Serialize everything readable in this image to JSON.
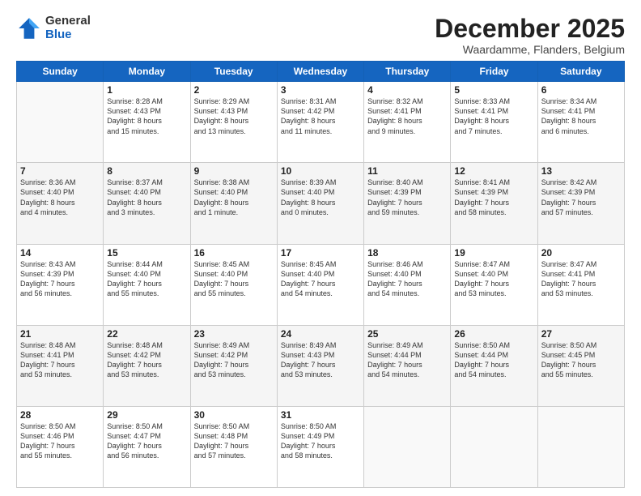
{
  "logo": {
    "general": "General",
    "blue": "Blue"
  },
  "header": {
    "month": "December 2025",
    "location": "Waardamme, Flanders, Belgium"
  },
  "weekdays": [
    "Sunday",
    "Monday",
    "Tuesday",
    "Wednesday",
    "Thursday",
    "Friday",
    "Saturday"
  ],
  "weeks": [
    [
      {
        "day": "",
        "info": ""
      },
      {
        "day": "1",
        "info": "Sunrise: 8:28 AM\nSunset: 4:43 PM\nDaylight: 8 hours\nand 15 minutes."
      },
      {
        "day": "2",
        "info": "Sunrise: 8:29 AM\nSunset: 4:43 PM\nDaylight: 8 hours\nand 13 minutes."
      },
      {
        "day": "3",
        "info": "Sunrise: 8:31 AM\nSunset: 4:42 PM\nDaylight: 8 hours\nand 11 minutes."
      },
      {
        "day": "4",
        "info": "Sunrise: 8:32 AM\nSunset: 4:41 PM\nDaylight: 8 hours\nand 9 minutes."
      },
      {
        "day": "5",
        "info": "Sunrise: 8:33 AM\nSunset: 4:41 PM\nDaylight: 8 hours\nand 7 minutes."
      },
      {
        "day": "6",
        "info": "Sunrise: 8:34 AM\nSunset: 4:41 PM\nDaylight: 8 hours\nand 6 minutes."
      }
    ],
    [
      {
        "day": "7",
        "info": "Sunrise: 8:36 AM\nSunset: 4:40 PM\nDaylight: 8 hours\nand 4 minutes."
      },
      {
        "day": "8",
        "info": "Sunrise: 8:37 AM\nSunset: 4:40 PM\nDaylight: 8 hours\nand 3 minutes."
      },
      {
        "day": "9",
        "info": "Sunrise: 8:38 AM\nSunset: 4:40 PM\nDaylight: 8 hours\nand 1 minute."
      },
      {
        "day": "10",
        "info": "Sunrise: 8:39 AM\nSunset: 4:40 PM\nDaylight: 8 hours\nand 0 minutes."
      },
      {
        "day": "11",
        "info": "Sunrise: 8:40 AM\nSunset: 4:39 PM\nDaylight: 7 hours\nand 59 minutes."
      },
      {
        "day": "12",
        "info": "Sunrise: 8:41 AM\nSunset: 4:39 PM\nDaylight: 7 hours\nand 58 minutes."
      },
      {
        "day": "13",
        "info": "Sunrise: 8:42 AM\nSunset: 4:39 PM\nDaylight: 7 hours\nand 57 minutes."
      }
    ],
    [
      {
        "day": "14",
        "info": "Sunrise: 8:43 AM\nSunset: 4:39 PM\nDaylight: 7 hours\nand 56 minutes."
      },
      {
        "day": "15",
        "info": "Sunrise: 8:44 AM\nSunset: 4:40 PM\nDaylight: 7 hours\nand 55 minutes."
      },
      {
        "day": "16",
        "info": "Sunrise: 8:45 AM\nSunset: 4:40 PM\nDaylight: 7 hours\nand 55 minutes."
      },
      {
        "day": "17",
        "info": "Sunrise: 8:45 AM\nSunset: 4:40 PM\nDaylight: 7 hours\nand 54 minutes."
      },
      {
        "day": "18",
        "info": "Sunrise: 8:46 AM\nSunset: 4:40 PM\nDaylight: 7 hours\nand 54 minutes."
      },
      {
        "day": "19",
        "info": "Sunrise: 8:47 AM\nSunset: 4:40 PM\nDaylight: 7 hours\nand 53 minutes."
      },
      {
        "day": "20",
        "info": "Sunrise: 8:47 AM\nSunset: 4:41 PM\nDaylight: 7 hours\nand 53 minutes."
      }
    ],
    [
      {
        "day": "21",
        "info": "Sunrise: 8:48 AM\nSunset: 4:41 PM\nDaylight: 7 hours\nand 53 minutes."
      },
      {
        "day": "22",
        "info": "Sunrise: 8:48 AM\nSunset: 4:42 PM\nDaylight: 7 hours\nand 53 minutes."
      },
      {
        "day": "23",
        "info": "Sunrise: 8:49 AM\nSunset: 4:42 PM\nDaylight: 7 hours\nand 53 minutes."
      },
      {
        "day": "24",
        "info": "Sunrise: 8:49 AM\nSunset: 4:43 PM\nDaylight: 7 hours\nand 53 minutes."
      },
      {
        "day": "25",
        "info": "Sunrise: 8:49 AM\nSunset: 4:44 PM\nDaylight: 7 hours\nand 54 minutes."
      },
      {
        "day": "26",
        "info": "Sunrise: 8:50 AM\nSunset: 4:44 PM\nDaylight: 7 hours\nand 54 minutes."
      },
      {
        "day": "27",
        "info": "Sunrise: 8:50 AM\nSunset: 4:45 PM\nDaylight: 7 hours\nand 55 minutes."
      }
    ],
    [
      {
        "day": "28",
        "info": "Sunrise: 8:50 AM\nSunset: 4:46 PM\nDaylight: 7 hours\nand 55 minutes."
      },
      {
        "day": "29",
        "info": "Sunrise: 8:50 AM\nSunset: 4:47 PM\nDaylight: 7 hours\nand 56 minutes."
      },
      {
        "day": "30",
        "info": "Sunrise: 8:50 AM\nSunset: 4:48 PM\nDaylight: 7 hours\nand 57 minutes."
      },
      {
        "day": "31",
        "info": "Sunrise: 8:50 AM\nSunset: 4:49 PM\nDaylight: 7 hours\nand 58 minutes."
      },
      {
        "day": "",
        "info": ""
      },
      {
        "day": "",
        "info": ""
      },
      {
        "day": "",
        "info": ""
      }
    ]
  ]
}
